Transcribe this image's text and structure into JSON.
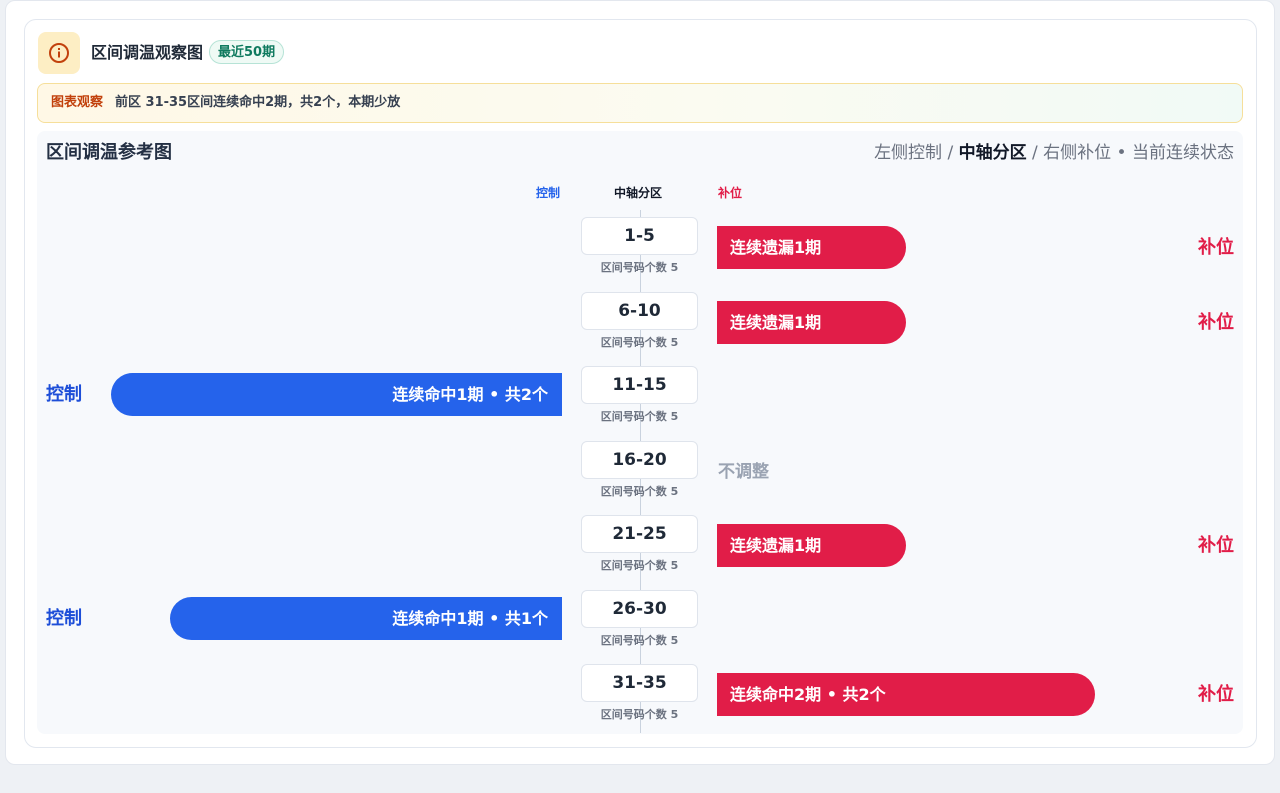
{
  "header": {
    "title": "区间调温观察图",
    "badge": "最近50期"
  },
  "note": {
    "label": "图表观察",
    "text": "前区 31-35区间连续命中2期，共2个，本期少放"
  },
  "panel": {
    "title": "区间调温参考图",
    "legend_part1": "左侧控制",
    "legend_sep1": " / ",
    "legend_part2": "中轴分区",
    "legend_sep2": " / ",
    "legend_part3": "右侧补位",
    "legend_part4": " • 当前连续状态"
  },
  "columns": {
    "left": "控制",
    "center": "中轴分区",
    "right": "补位"
  },
  "colors": {
    "control": "#2563eb",
    "fill": "#e11d48",
    "neutral": "#9aa3b2",
    "badge": "#0f7a5f",
    "note_label": "#c2410c"
  },
  "rows": [
    {
      "range": "1-5",
      "sub": "区间号码个数 5",
      "left_tag": "",
      "left_bar": "",
      "left_level": 0,
      "right_bar": "连续遗漏1期",
      "right_level": 0.42,
      "right_tag": "补位",
      "neutral": ""
    },
    {
      "range": "6-10",
      "sub": "区间号码个数 5",
      "left_tag": "",
      "left_bar": "",
      "left_level": 0,
      "right_bar": "连续遗漏1期",
      "right_level": 0.42,
      "right_tag": "补位",
      "neutral": ""
    },
    {
      "range": "11-15",
      "sub": "区间号码个数 5",
      "left_tag": "控制",
      "left_bar": "连续命中1期 • 共2个",
      "left_level": 1.0,
      "right_bar": "",
      "right_level": 0,
      "right_tag": "",
      "neutral": ""
    },
    {
      "range": "16-20",
      "sub": "区间号码个数 5",
      "left_tag": "",
      "left_bar": "",
      "left_level": 0,
      "right_bar": "",
      "right_level": 0,
      "right_tag": "",
      "neutral": "不调整"
    },
    {
      "range": "21-25",
      "sub": "区间号码个数 5",
      "left_tag": "",
      "left_bar": "",
      "left_level": 0,
      "right_bar": "连续遗漏1期",
      "right_level": 0.42,
      "right_tag": "补位",
      "neutral": ""
    },
    {
      "range": "26-30",
      "sub": "区间号码个数 5",
      "left_tag": "控制",
      "left_bar": "连续命中1期 • 共1个",
      "left_level": 0.87,
      "right_bar": "",
      "right_level": 0,
      "right_tag": "",
      "neutral": ""
    },
    {
      "range": "31-35",
      "sub": "区间号码个数 5",
      "left_tag": "",
      "left_bar": "",
      "left_level": 0,
      "right_bar": "连续命中2期 • 共2个",
      "right_level": 0.84,
      "right_tag": "补位",
      "neutral": ""
    }
  ]
}
